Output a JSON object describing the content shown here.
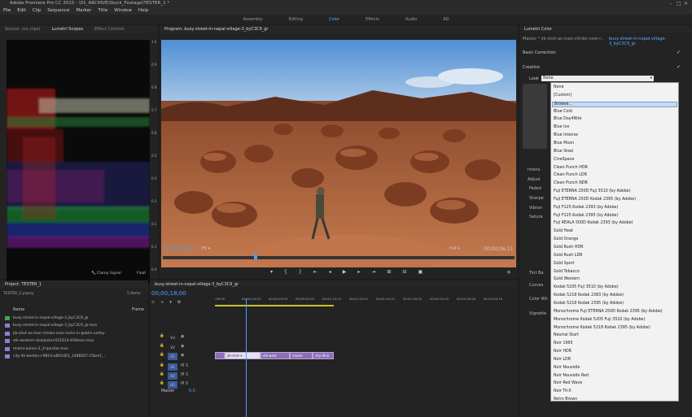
{
  "window": {
    "title": "Adobe Premiere Pro CC 2015 - \\01_ARCHIVE\\Stock_Footage\\TESTER_1 *",
    "controls": [
      "–",
      "□",
      "✕"
    ]
  },
  "menu": [
    "File",
    "Edit",
    "Clip",
    "Sequence",
    "Marker",
    "Title",
    "Window",
    "Help"
  ],
  "workspaces": {
    "items": [
      "Assembly",
      "Editing",
      "Color",
      "Effects",
      "Audio",
      "AD"
    ],
    "active": "Color"
  },
  "scopes_panel": {
    "tabs": [
      "Source: (no clips)",
      "Lumetri Scopes",
      "Effect Controls"
    ],
    "active_tab": "Lumetri Scopes",
    "axis": [
      "1.0",
      "0.9",
      "0.8",
      "0.7",
      "0.6",
      "0.5",
      "0.4",
      "0.3",
      "0.2",
      "0.1",
      "0.0"
    ],
    "clamp_signal": "Clamp Signal",
    "float_label": "Float"
  },
  "program": {
    "title": "Program: busy-street-in-nepal-village-3_byC3C9_gr",
    "timecode_in": "00;00;18;00",
    "fit": "Fit",
    "quality": "Full",
    "timecode_out": "00;00;06;11"
  },
  "lumetri": {
    "tab": "Lumetri Color",
    "master_label": "Master * jib-shot-as-man-climbs-over-r...",
    "master_clip": "busy-street-in-nepal-village-3_byC3C9_gr",
    "basic_correction": "Basic Correction",
    "creative": "Creative",
    "look_label": "Look",
    "look_value": "None",
    "side_labels": [
      "Intens",
      "Adjust",
      "Faded",
      "Sharpe",
      "Vibran",
      "Satura",
      "Tint Ba",
      "Curves",
      "Color Wh",
      "Vignette"
    ],
    "dropdown": [
      "None",
      "[Custom]",
      "Browse...",
      "Blue Cold",
      "Blue Day4Nite",
      "Blue Ice",
      "Blue Intense",
      "Blue Moon",
      "Blue Steel",
      "CineSpace",
      "Clean Punch HDR",
      "Clean Punch LDR",
      "Clean Punch NDR",
      "Fuji ETERNA 250D Fuji 3510 (by Adobe)",
      "Fuji ETERNA 250D Kodak 2395 (by Adobe)",
      "Fuji F125 Kodak 2393 (by Adobe)",
      "Fuji F125 Kodak 2395 (by Adobe)",
      "Fuji REALA 500D Kodak 2393 (by Adobe)",
      "Gold Heat",
      "Gold Orange",
      "Gold Rush HDR",
      "Gold Rush LDR",
      "Gold Sport",
      "Gold Tobacco",
      "Gold Western",
      "Kodak 5205 Fuji 3510 (by Adobe)",
      "Kodak 5218 Kodak 2383 (by Adobe)",
      "Kodak 5218 Kodak 2395 (by Adobe)",
      "Monochrome Fuji ETERNA 250D Kodak 2395 (by Adobe)",
      "Monochrome Kodak 5205 Fuji 3510 (by Adobe)",
      "Monochrome Kodak 5218 Kodak 2395 (by Adobe)",
      "Neutral Start",
      "Noir 1965",
      "Noir HDR",
      "Noir LDR",
      "Noir Nouvelle",
      "Noir Nouvelle Red",
      "Noir Red Wave",
      "Noir Tri-X",
      "Retro Brown"
    ],
    "highlighted": "Browse..."
  },
  "project": {
    "title": "Project: TESTER_1",
    "file": "TESTER_1.prproj",
    "items_count": "5 Items",
    "col_name": "Name",
    "col_frame": "Frame",
    "files": [
      {
        "name": "busy-street-in-nepal-village-3_byC3C9_gr",
        "color": "#3fa84a"
      },
      {
        "name": "busy-street-in-nepal-village-3_byC3C9_gr.mov",
        "color": "#8f7fd0"
      },
      {
        "name": "jib-shot-as-man-climbs-over-rocks-in-goblin-valley-",
        "color": "#8f7fd0"
      },
      {
        "name": "stk-western-dualpistol-021614-658mov.mov",
        "color": "#8f7fd0"
      },
      {
        "name": "miami-police-3_2ripos0ar.mov",
        "color": "#8f7fd0"
      },
      {
        "name": "city-4k-boston-l-9814-a802d01_1488267-15bmf_...",
        "color": "#8f7fd0"
      }
    ]
  },
  "timeline": {
    "tab": "busy-street-in-nepal-village-3_byC3C9_gr",
    "timecode": "00;00;18;00",
    "ruler": [
      ":00:00",
      "00:00:14:23",
      "00:00:29:23",
      "00:00:44:22",
      "00:01:14:22",
      "00:01:29:21",
      "00:01:44:21",
      "00:01:59:21",
      "00:02:14:20",
      "00:02:29:20",
      "00:02:44:19"
    ],
    "tracks": [
      "V3",
      "V2",
      "V1",
      "A1",
      "A2",
      "A3"
    ],
    "master": "Master",
    "master_val": "0.0",
    "clips": [
      "",
      "jib-shot-a",
      "stk-west",
      "miami",
      "city-4k-b"
    ]
  },
  "colors": {
    "accent": "#5aaeff",
    "clip_purple": "#8c6fb5",
    "playhead": "#4aa3ff"
  }
}
